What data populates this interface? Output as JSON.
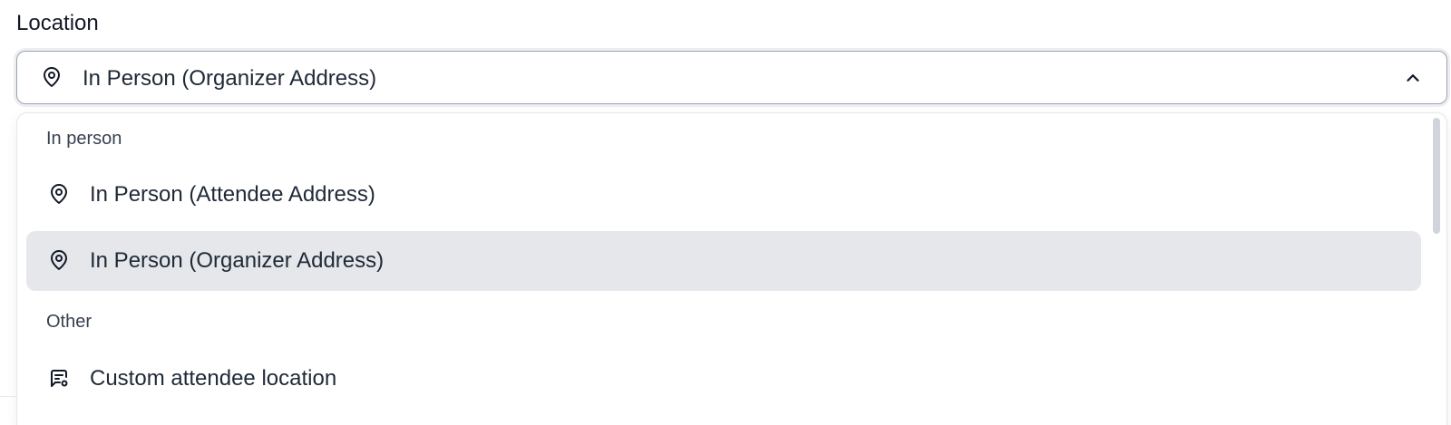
{
  "field": {
    "label": "Location"
  },
  "select": {
    "value": "In Person (Organizer Address)",
    "icon": "map-pin-icon",
    "expanded": true
  },
  "dropdown": {
    "groups": [
      {
        "heading": "In person",
        "options": [
          {
            "label": "In Person (Attendee Address)",
            "icon": "map-pin-icon",
            "selected": false
          },
          {
            "label": "In Person (Organizer Address)",
            "icon": "map-pin-icon",
            "selected": true
          }
        ]
      },
      {
        "heading": "Other",
        "options": [
          {
            "label": "Custom attendee location",
            "icon": "message-location-icon",
            "selected": false
          }
        ]
      }
    ]
  },
  "colors": {
    "text": "#1f2937",
    "border": "#9ca3af",
    "selected_bg": "#e5e7eb",
    "muted_text": "#374151"
  }
}
